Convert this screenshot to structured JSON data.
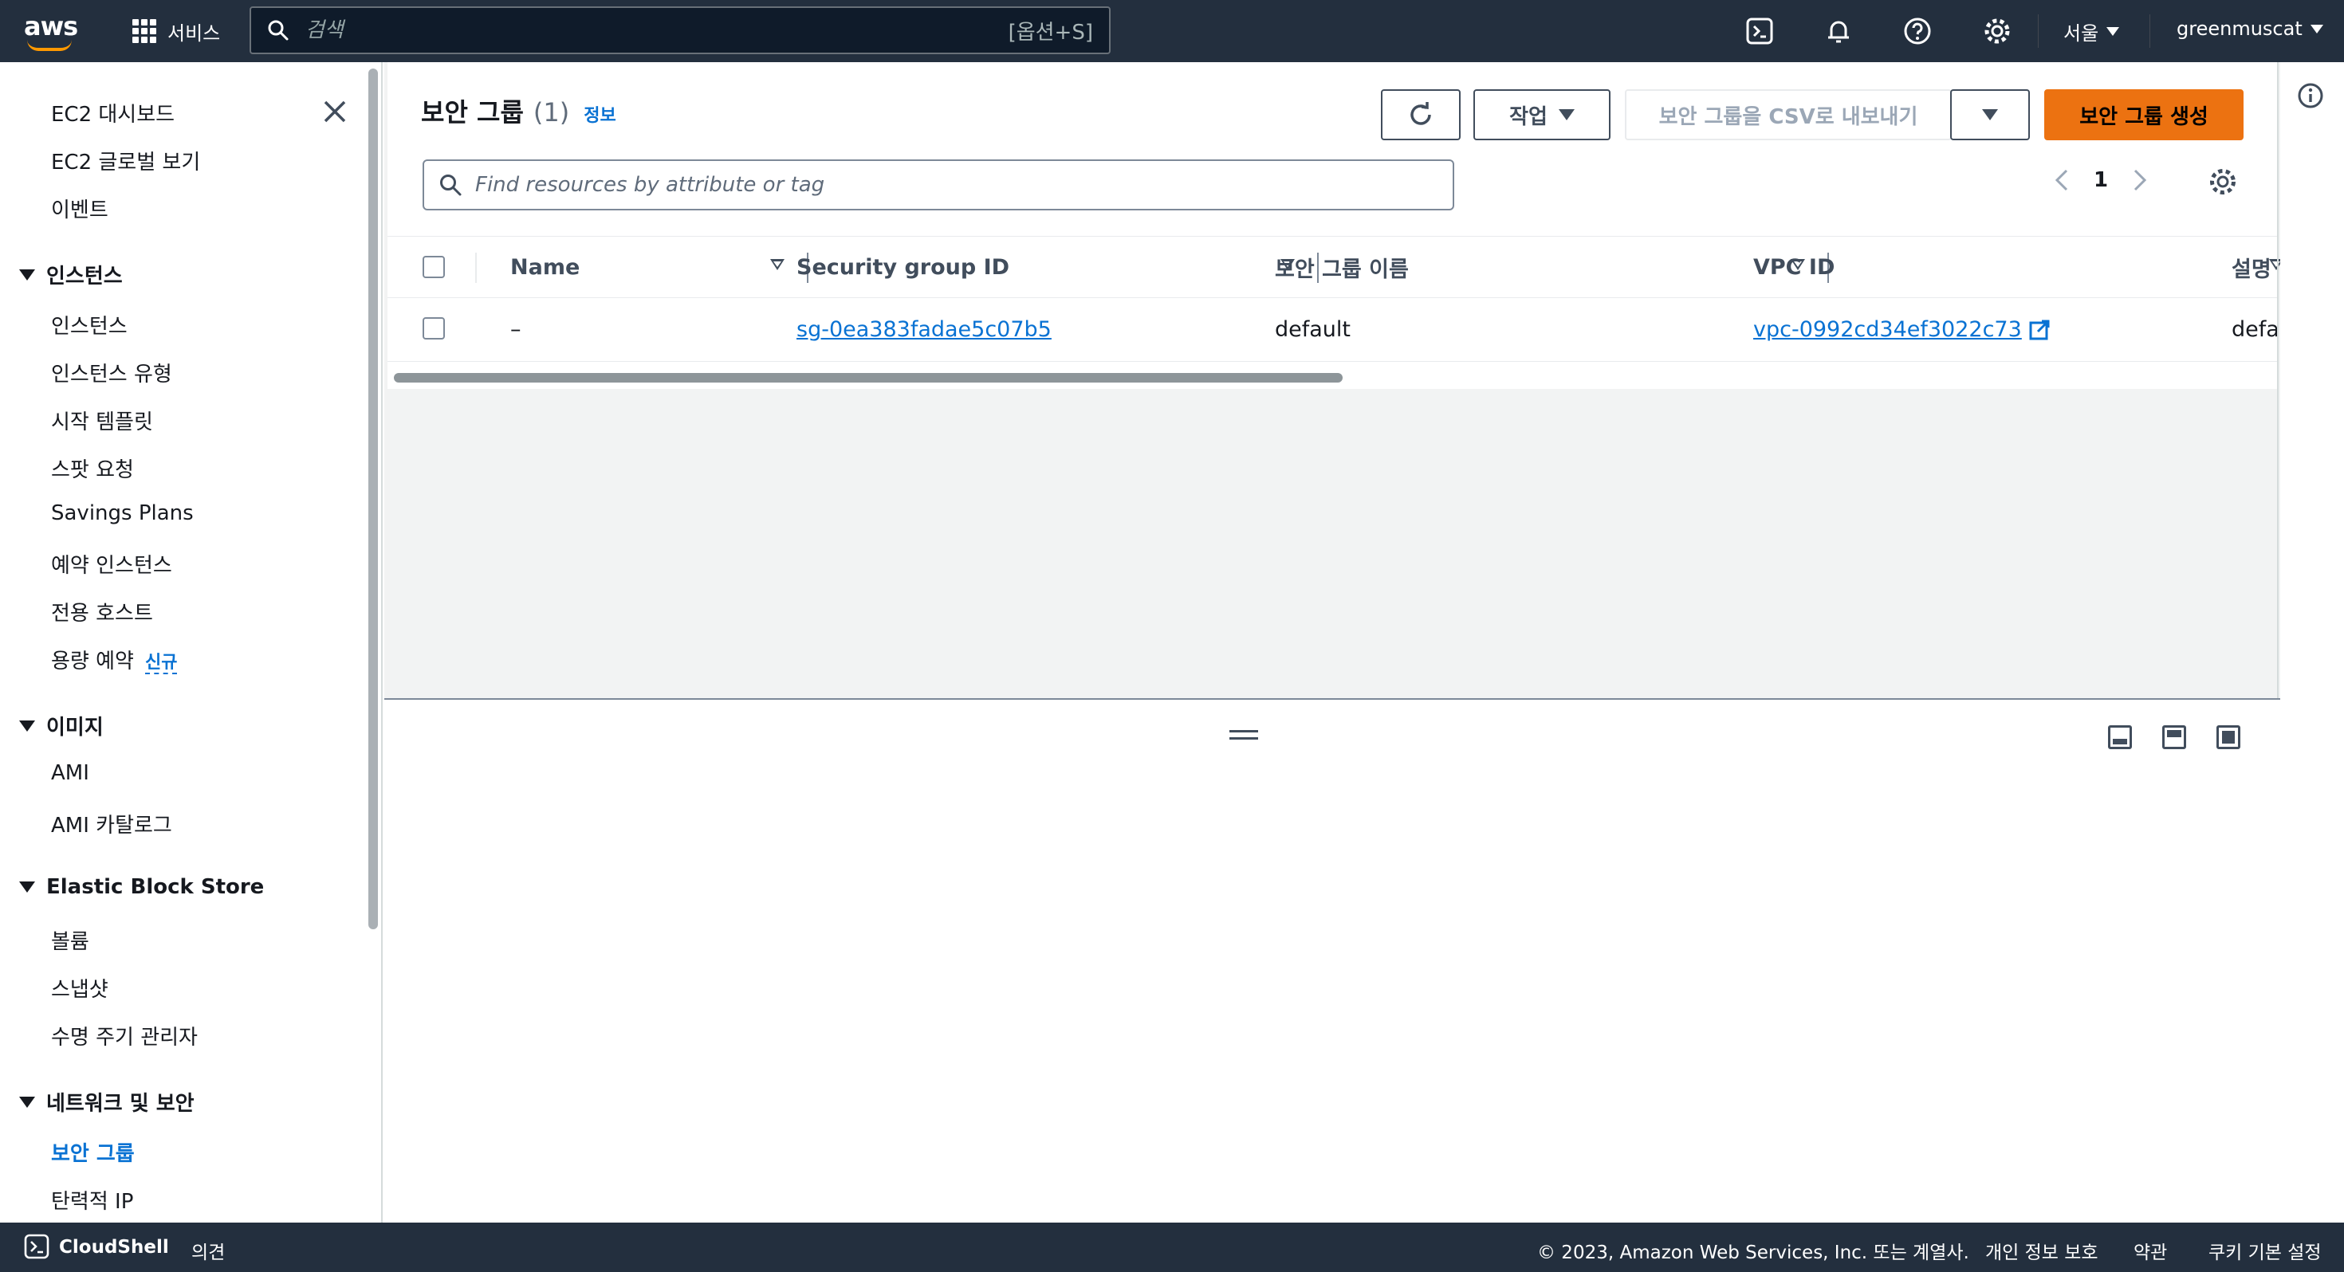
{
  "topbar": {
    "logo": "aws",
    "services_label": "서비스",
    "search_placeholder": "검색",
    "search_shortcut": "[옵션+S]",
    "region": "서울",
    "user": "greenmuscat",
    "icons": [
      "cloudshell-icon",
      "bell-icon",
      "help-icon",
      "gear-icon"
    ]
  },
  "sidebar": {
    "top_items": [
      {
        "label": "EC2 대시보드"
      },
      {
        "label": "EC2 글로벌 보기"
      },
      {
        "label": "이벤트"
      }
    ],
    "sections": [
      {
        "title": "인스턴스",
        "items": [
          "인스턴스",
          "인스턴스 유형",
          "시작 템플릿",
          "스팟 요청",
          "Savings Plans",
          "예약 인스턴스",
          "전용 호스트",
          "용량 예약"
        ]
      },
      {
        "title": "이미지",
        "items": [
          "AMI",
          "AMI 카탈로그"
        ]
      },
      {
        "title": "Elastic Block Store",
        "items": [
          "볼륨",
          "스냅샷",
          "수명 주기 관리자"
        ]
      },
      {
        "title": "네트워크 및 보안",
        "items": [
          "보안 그룹",
          "탄력적 IP"
        ]
      }
    ],
    "new_badge": "신규"
  },
  "main": {
    "title": "보안 그룹",
    "count": "(1)",
    "info_link": "정보",
    "actions_label": "작업",
    "export_label": "보안 그룹을 CSV로 내보내기",
    "create_label": "보안 그룹 생성",
    "filter_placeholder": "Find resources by attribute or tag",
    "page_number": "1"
  },
  "table": {
    "columns": [
      "Name",
      "Security group ID",
      "보안 그룹 이름",
      "VPC ID",
      "설명"
    ],
    "rows": [
      {
        "name": "–",
        "sg_id": "sg-0ea383fadae5c07b5",
        "sg_name": "default",
        "vpc_id": "vpc-0992cd34ef3022c73",
        "description": "defa"
      }
    ]
  },
  "footer": {
    "cloudshell": "CloudShell",
    "feedback": "의견",
    "copyright": "© 2023, Amazon Web Services, Inc. 또는 계열사.",
    "privacy": "개인 정보 보호",
    "terms": "약관",
    "cookies": "쿠키 기본 설정"
  },
  "colors": {
    "nav_bg": "#232f3e",
    "primary": "#ec7211",
    "link": "#0972d3"
  }
}
